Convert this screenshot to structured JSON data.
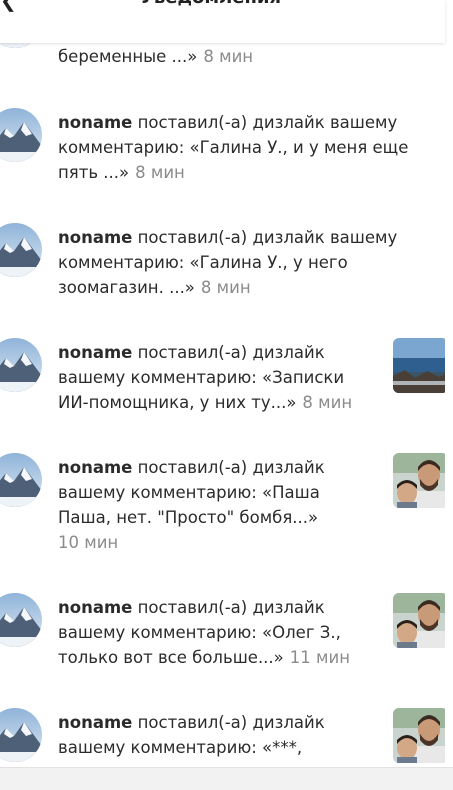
{
  "header": {
    "title": "Уведомления",
    "back_icon": "arrow-left-icon"
  },
  "notifications": [
    {
      "user": "",
      "text": "беременные ...»",
      "time": "8 мин",
      "avatar_icon": "mountain-avatar-icon",
      "thumbnail": null
    },
    {
      "user": "noname",
      "text_lines": [
        "поставил(-а) дизлайк вашему",
        "комментарию: «Галина У., и у меня еще",
        "пять ...»"
      ],
      "time": "8 мин",
      "avatar_icon": "mountain-avatar-icon",
      "thumbnail": null
    },
    {
      "user": "noname",
      "text_lines": [
        "поставил(-а) дизлайк вашему",
        "комментарию: «Галина У., у него",
        "зоомагазин. ...»"
      ],
      "time": "8 мин",
      "avatar_icon": "mountain-avatar-icon",
      "thumbnail": null
    },
    {
      "user": "noname",
      "text_lines": [
        "поставил(-а) дизлайк",
        "вашему комментарию: «Записки",
        "ИИ-помощника, у них ту...»"
      ],
      "time": "8 мин",
      "avatar_icon": "mountain-avatar-icon",
      "thumbnail": "seascape-thumbnail"
    },
    {
      "user": "noname",
      "text_lines": [
        "поставил(-а) дизлайк",
        "вашему комментарию: «Паша",
        "Паша, нет. \"Просто\" бомбя...»"
      ],
      "time": "10 мин",
      "avatar_icon": "mountain-avatar-icon",
      "thumbnail": "people-photo-thumbnail"
    },
    {
      "user": "noname",
      "text_lines": [
        "поставил(-а) дизлайк",
        "вашему комментарию: «Олег З.,",
        "только вот все больше...»"
      ],
      "time": "11 мин",
      "avatar_icon": "mountain-avatar-icon",
      "thumbnail": "people-photo-thumbnail"
    },
    {
      "user": "noname",
      "text_lines": [
        "поставил(-а) дизлайк",
        "вашему комментарию: «***,"
      ],
      "time": "",
      "avatar_icon": "mountain-avatar-icon",
      "thumbnail": "people-photo-thumbnail"
    }
  ],
  "colors": {
    "text": "#2b2b2b",
    "time": "#8b8b8b",
    "background": "#ffffff",
    "bottom_bar": "#f2f2f2"
  }
}
